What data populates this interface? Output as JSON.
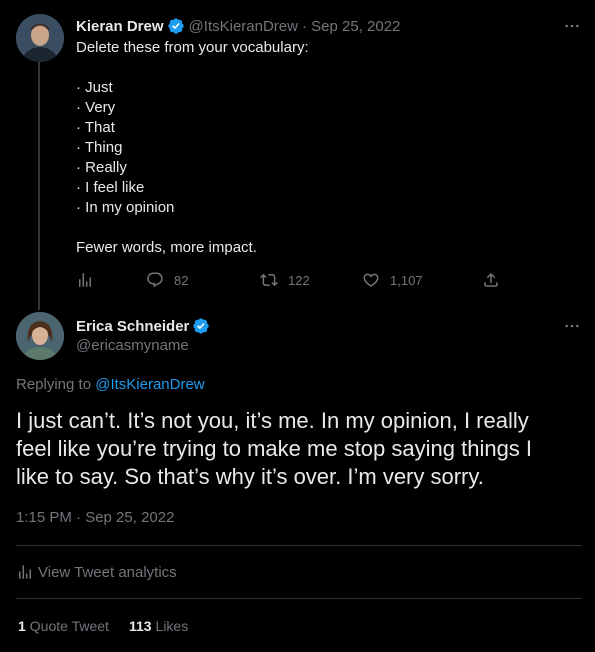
{
  "original_tweet": {
    "author_name": "Kieran Drew",
    "handle": "@ItsKieranDrew",
    "date": "· Sep 25, 2022",
    "text_lines": [
      "Delete these from your vocabulary:",
      "",
      "· Just",
      "· Very",
      "· That",
      "· Thing",
      "· Really",
      "· I feel like",
      "· In my opinion",
      "",
      "Fewer words, more impact."
    ],
    "reply_count": "82",
    "retweet_count": "122",
    "like_count": "1,107"
  },
  "reply_tweet": {
    "author_name": "Erica Schneider",
    "handle": "@ericasmyname",
    "replying_prefix": "Replying to",
    "replying_to": "@ItsKieranDrew",
    "text_lines": [
      "I just can’t. It’s not you, it’s me. In my opinion, I really",
      "feel like you’re trying to make me stop saying things I",
      "like to say. So that’s why it’s over. I’m very sorry."
    ],
    "timestamp": "1:15 PM · Sep 25, 2022",
    "analytics_label": "View Tweet analytics",
    "quote_tweet_count": "1",
    "quote_tweet_label": "Quote Tweet",
    "likes_count": "113",
    "likes_label": "Likes"
  },
  "colors": {
    "background": "#000000",
    "text": "#e7e9ea",
    "muted": "#71767b",
    "accent": "#1d9bf0",
    "divider": "#2f3336"
  },
  "icons": [
    "more-icon",
    "verified-icon",
    "analytics-icon",
    "reply-icon",
    "retweet-icon",
    "like-icon",
    "share-icon"
  ]
}
